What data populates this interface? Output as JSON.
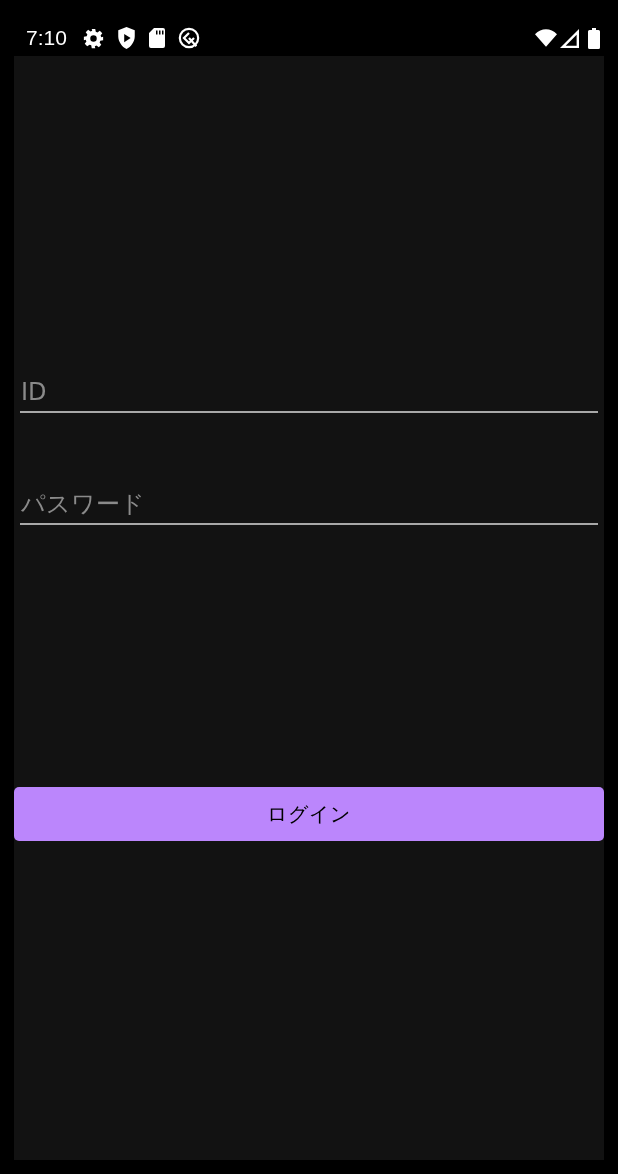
{
  "status_bar": {
    "time": "7:10"
  },
  "form": {
    "fields": [
      {
        "placeholder": "ID"
      },
      {
        "placeholder": "パスワード"
      }
    ],
    "button": {
      "label": "ログイン"
    }
  }
}
